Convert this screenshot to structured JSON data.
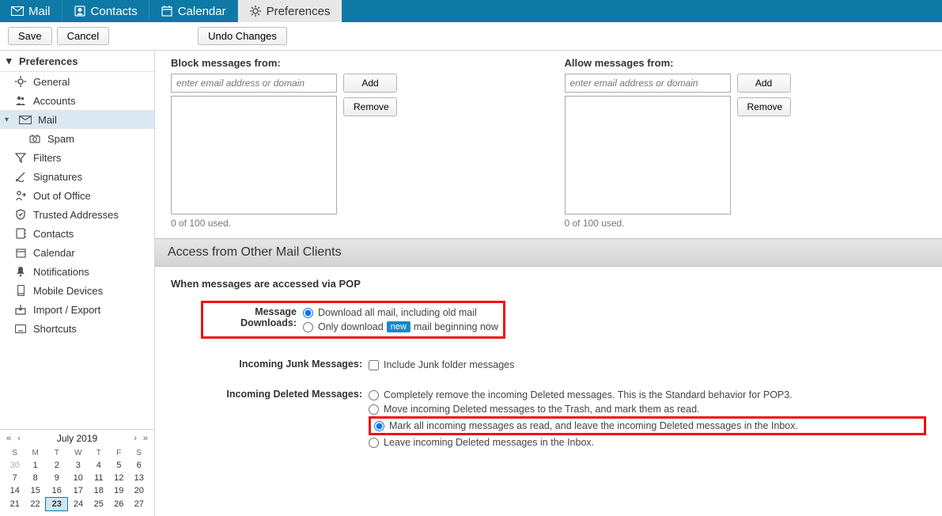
{
  "topnav": {
    "tabs": [
      {
        "id": "mail",
        "label": "Mail"
      },
      {
        "id": "contacts",
        "label": "Contacts"
      },
      {
        "id": "calendar",
        "label": "Calendar"
      },
      {
        "id": "preferences",
        "label": "Preferences"
      }
    ],
    "active": "preferences"
  },
  "toolbar": {
    "save": "Save",
    "cancel": "Cancel",
    "undo": "Undo Changes"
  },
  "sidebar": {
    "header": "Preferences",
    "items": [
      {
        "id": "general",
        "label": "General"
      },
      {
        "id": "accounts",
        "label": "Accounts"
      },
      {
        "id": "mail",
        "label": "Mail",
        "selected": true,
        "expandable": true
      },
      {
        "id": "spam",
        "label": "Spam",
        "sub": true
      },
      {
        "id": "filters",
        "label": "Filters"
      },
      {
        "id": "signatures",
        "label": "Signatures"
      },
      {
        "id": "ooo",
        "label": "Out of Office"
      },
      {
        "id": "trusted",
        "label": "Trusted Addresses"
      },
      {
        "id": "contacts",
        "label": "Contacts"
      },
      {
        "id": "calendar",
        "label": "Calendar"
      },
      {
        "id": "notifications",
        "label": "Notifications"
      },
      {
        "id": "mobile",
        "label": "Mobile Devices"
      },
      {
        "id": "import",
        "label": "Import / Export"
      },
      {
        "id": "shortcuts",
        "label": "Shortcuts"
      }
    ]
  },
  "mini_calendar": {
    "title": "July 2019",
    "dow": [
      "S",
      "M",
      "T",
      "W",
      "T",
      "F",
      "S"
    ],
    "weeks": [
      [
        {
          "d": "30",
          "o": true
        },
        {
          "d": "1"
        },
        {
          "d": "2"
        },
        {
          "d": "3"
        },
        {
          "d": "4"
        },
        {
          "d": "5"
        },
        {
          "d": "6"
        }
      ],
      [
        {
          "d": "7"
        },
        {
          "d": "8"
        },
        {
          "d": "9"
        },
        {
          "d": "10"
        },
        {
          "d": "11"
        },
        {
          "d": "12"
        },
        {
          "d": "13"
        }
      ],
      [
        {
          "d": "14"
        },
        {
          "d": "15"
        },
        {
          "d": "16"
        },
        {
          "d": "17"
        },
        {
          "d": "18"
        },
        {
          "d": "19"
        },
        {
          "d": "20"
        }
      ],
      [
        {
          "d": "21"
        },
        {
          "d": "22"
        },
        {
          "d": "23",
          "today": true
        },
        {
          "d": "24"
        },
        {
          "d": "25"
        },
        {
          "d": "26"
        },
        {
          "d": "27"
        }
      ]
    ]
  },
  "block": {
    "block_title": "Block messages from:",
    "allow_title": "Allow messages from:",
    "placeholder": "enter email address or domain",
    "add": "Add",
    "remove": "Remove",
    "usage": "0 of 100 used."
  },
  "pop": {
    "header": "Access from Other Mail Clients",
    "subheader": "When messages are accessed via POP",
    "downloads_label": "Message Downloads:",
    "downloads_opt1": "Download all mail, including old mail",
    "downloads_opt2_a": "Only download",
    "downloads_opt2_new": "new",
    "downloads_opt2_b": "mail beginning now",
    "junk_label": "Incoming Junk Messages:",
    "junk_opt": "Include Junk folder messages",
    "del_label": "Incoming Deleted Messages:",
    "del_opt1": "Completely remove the incoming Deleted messages. This is the Standard behavior for POP3.",
    "del_opt2": "Move incoming Deleted messages to the Trash, and mark them as read.",
    "del_opt3": "Mark all incoming messages as read, and leave the incoming Deleted messages in the Inbox.",
    "del_opt4": "Leave incoming Deleted messages in the Inbox."
  }
}
